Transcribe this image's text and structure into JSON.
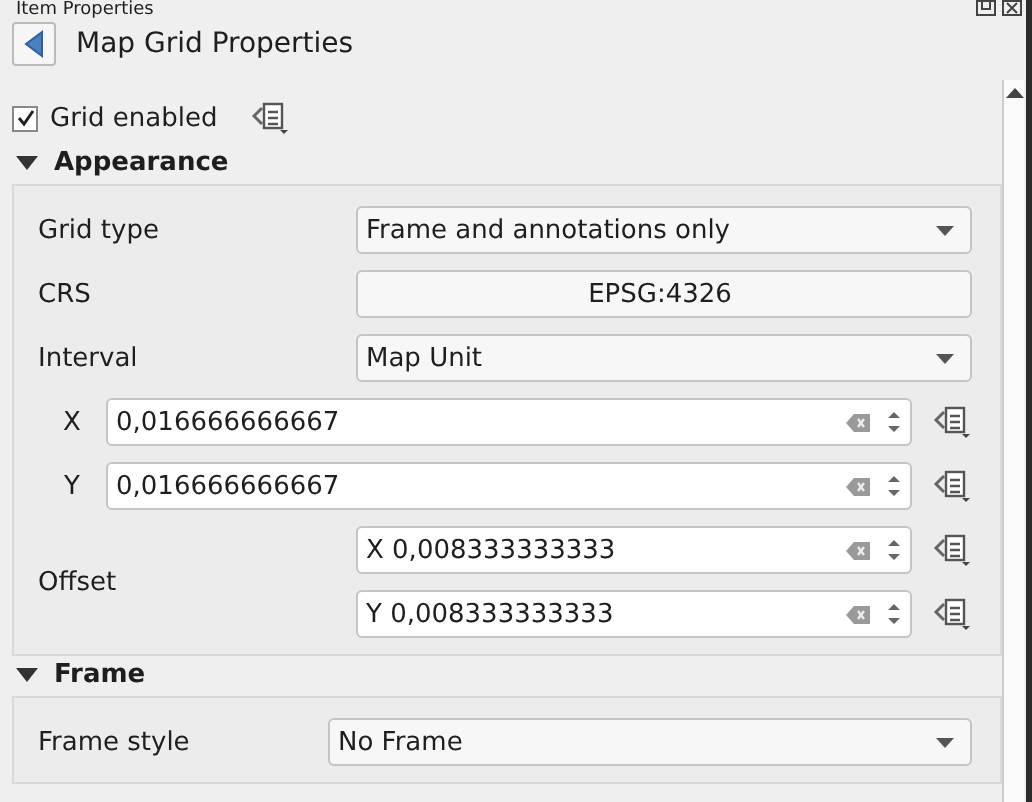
{
  "panel_title": "Item Properties",
  "page": {
    "title": "Map Grid Properties"
  },
  "grid_enabled": {
    "label": "Grid enabled",
    "checked": true
  },
  "sections": [
    {
      "title": "Appearance",
      "expanded": true,
      "rows": [
        {
          "kind": "combo",
          "label": "Grid type",
          "value": "Frame and annotations only"
        },
        {
          "kind": "button",
          "label": "CRS",
          "value": "EPSG:4326"
        },
        {
          "kind": "combo",
          "label": "Interval",
          "value": "Map Unit"
        },
        {
          "kind": "spin",
          "label": "X",
          "value": "0,016666666667"
        },
        {
          "kind": "spin",
          "label": "Y",
          "value": "0,016666666667"
        },
        {
          "kind": "offset",
          "label": "Offset",
          "values": [
            "X 0,008333333333",
            "Y 0,008333333333"
          ]
        }
      ]
    },
    {
      "title": "Frame",
      "expanded": true,
      "rows": [
        {
          "kind": "combo",
          "label": "Frame style",
          "value": "No Frame"
        }
      ]
    }
  ]
}
